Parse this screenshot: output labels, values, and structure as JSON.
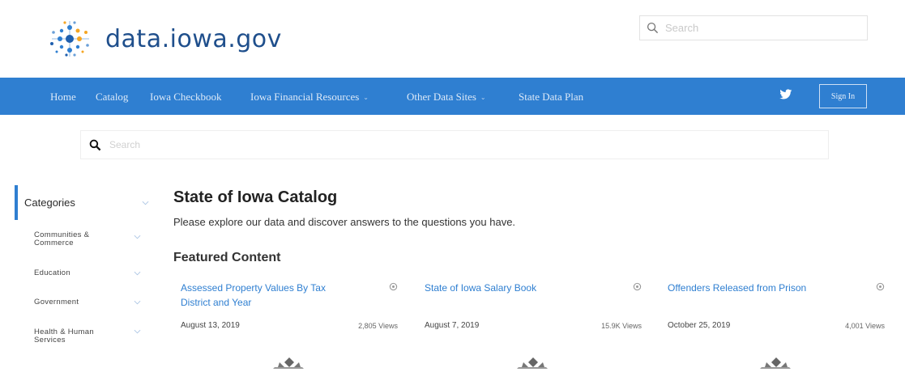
{
  "header": {
    "site_name": "data.iowa.gov",
    "search_placeholder": "Search"
  },
  "nav": {
    "items": [
      {
        "label": "Home",
        "has_dropdown": false
      },
      {
        "label": "Catalog",
        "has_dropdown": false
      },
      {
        "label": "Iowa Checkbook",
        "has_dropdown": false
      },
      {
        "label": "Iowa Financial Resources",
        "has_dropdown": true
      },
      {
        "label": "Other Data Sites",
        "has_dropdown": true
      },
      {
        "label": "State Data Plan",
        "has_dropdown": false
      }
    ],
    "sign_in_label": "Sign In",
    "twitter_icon": "twitter-icon"
  },
  "main_search": {
    "placeholder": "Search"
  },
  "sidebar": {
    "header": "Categories",
    "items": [
      {
        "label": "Communities & Commerce"
      },
      {
        "label": "Education"
      },
      {
        "label": "Government"
      },
      {
        "label": "Health & Human Services"
      }
    ]
  },
  "content": {
    "title": "State of Iowa Catalog",
    "description": "Please explore our data and discover answers to the questions you have.",
    "featured_heading": "Featured Content",
    "cards": [
      {
        "title": "Assessed Property Values By Tax District and Year",
        "date": "August 13, 2019",
        "views": "2,805 Views"
      },
      {
        "title": "State of Iowa Salary Book",
        "date": "August 7, 2019",
        "views": "15.9K Views"
      },
      {
        "title": "Offenders Released from Prison",
        "date": "October 25, 2019",
        "views": "4,001 Views"
      }
    ]
  },
  "colors": {
    "brand_blue": "#2f7fd1",
    "logo_text": "#1f4f8c",
    "logo_orange": "#f5a623"
  }
}
